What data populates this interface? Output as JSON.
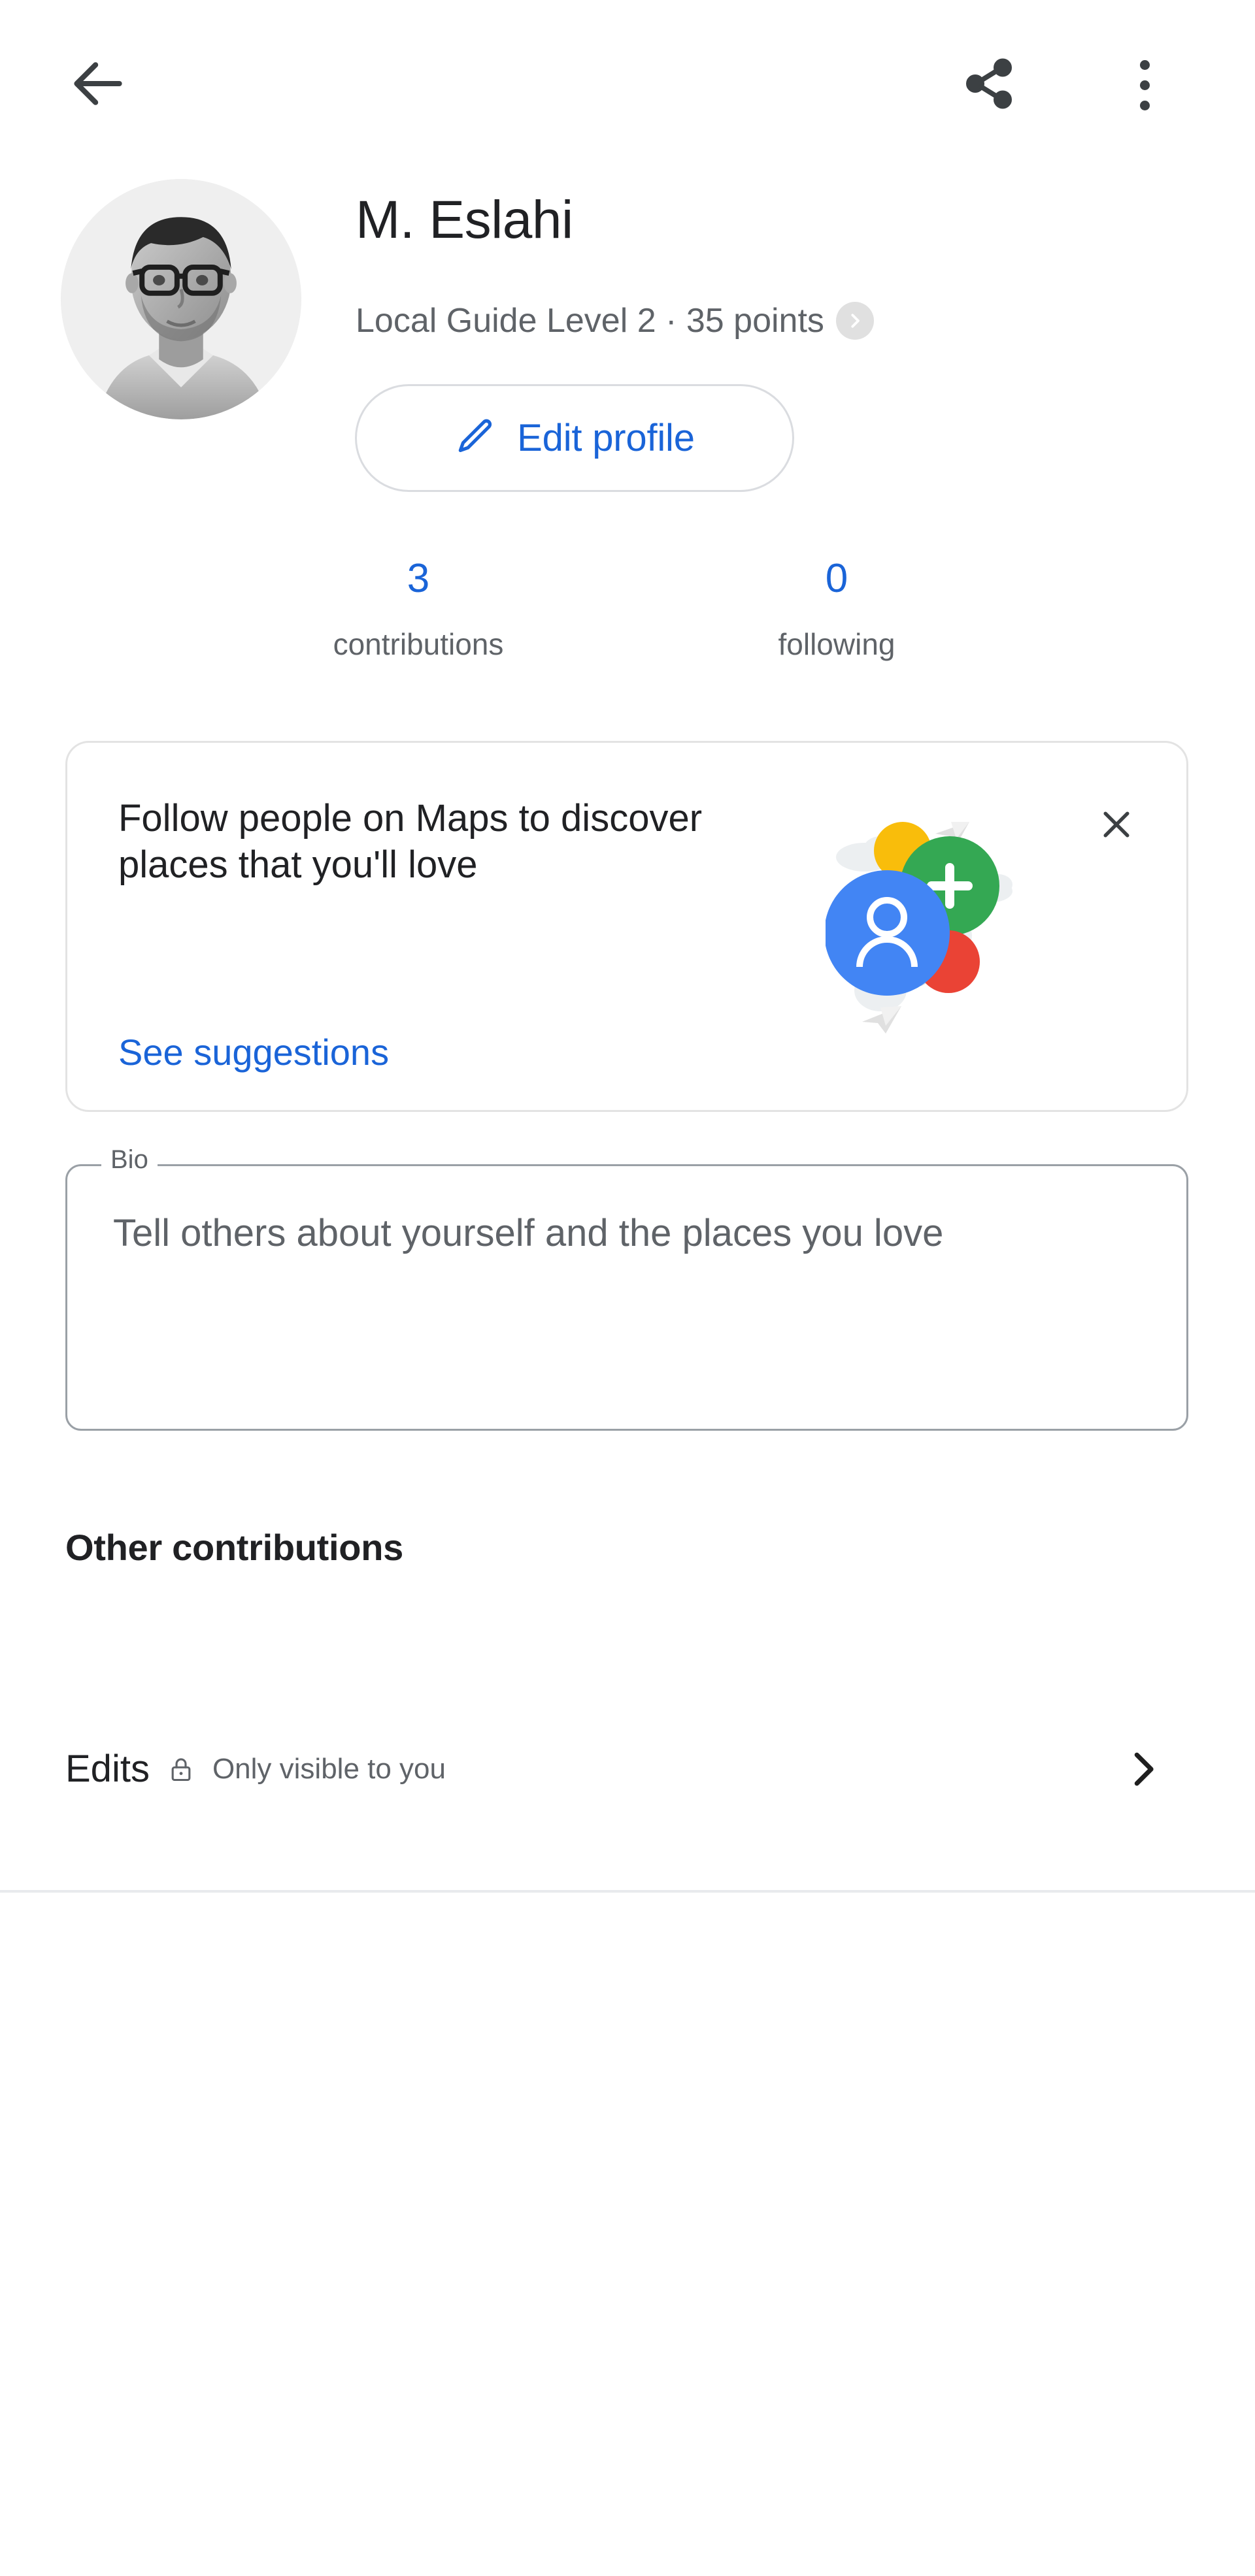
{
  "appbar": {
    "back_icon": "arrow-back-icon",
    "share_icon": "share-icon",
    "overflow_icon": "more-vert-icon"
  },
  "profile": {
    "avatar_alt": "profile-photo",
    "display_name": "M. Eslahi",
    "level_text": "Local Guide Level 2 · 35 points",
    "level_chevron_icon": "chevron-right-icon",
    "edit_button": {
      "label": "Edit profile",
      "icon": "pencil-icon"
    },
    "accent_color": "#1a64d8",
    "stats": [
      {
        "value": "3",
        "label": "contributions"
      },
      {
        "value": "0",
        "label": "following"
      }
    ]
  },
  "promo_card": {
    "headline": "Follow people on Maps to discover places that you'll love",
    "link_label": "See suggestions",
    "close_icon": "close-icon",
    "illustration_name": "follow-people-illustration",
    "illustration_colors": {
      "avatar_blue": "#4285f4",
      "yellow": "#f9bd0b",
      "green": "#34a853",
      "red": "#ea4335",
      "cloud_gray": "#eceff1",
      "connector": "#3c4043"
    }
  },
  "bio": {
    "legend": "Bio",
    "placeholder": "Tell others about yourself and the places you love",
    "value": ""
  },
  "other_contributions": {
    "section_title": "Other contributions",
    "rows": [
      {
        "title": "Edits",
        "visibility_icon": "lock-icon",
        "visibility_note": "Only visible to you",
        "chevron_icon": "chevron-right-icon"
      }
    ]
  }
}
